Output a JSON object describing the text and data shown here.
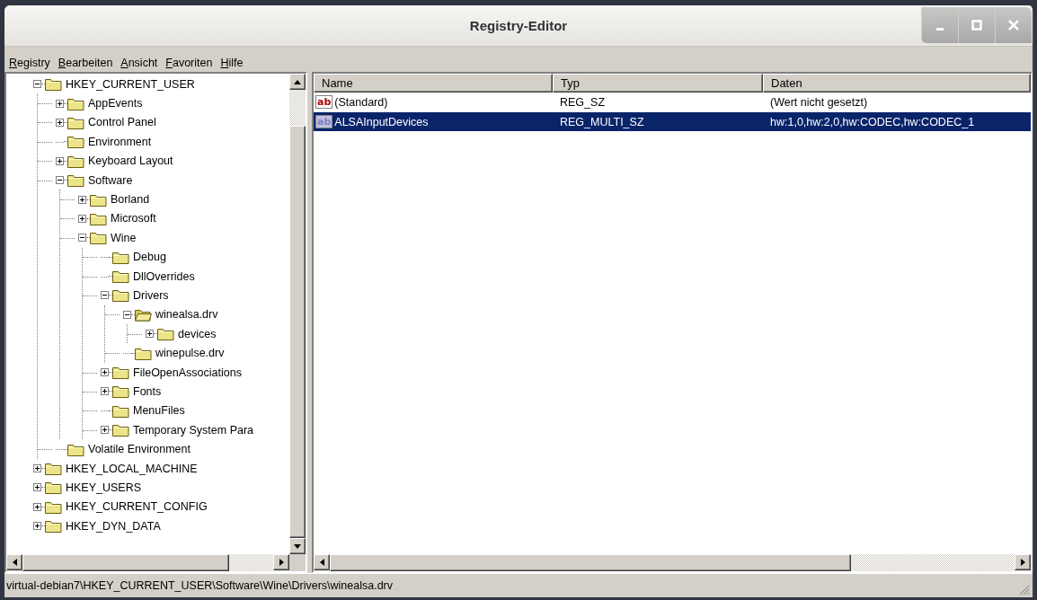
{
  "window": {
    "title": "Registry-Editor"
  },
  "menu": [
    "Registry",
    "Bearbeiten",
    "Ansicht",
    "Favoriten",
    "Hilfe"
  ],
  "tree": [
    {
      "label": "HKEY_CURRENT_USER",
      "kind": "branch",
      "expanded": true,
      "selected": false,
      "children": [
        {
          "label": "AppEvents",
          "kind": "branch",
          "expanded": false,
          "selected": false
        },
        {
          "label": "Control Panel",
          "kind": "branch",
          "expanded": false,
          "selected": false
        },
        {
          "label": "Environment",
          "kind": "leaf",
          "selected": false
        },
        {
          "label": "Keyboard Layout",
          "kind": "branch",
          "expanded": false,
          "selected": false
        },
        {
          "label": "Software",
          "kind": "branch",
          "expanded": true,
          "selected": false,
          "children": [
            {
              "label": "Borland",
              "kind": "branch",
              "expanded": false,
              "selected": false
            },
            {
              "label": "Microsoft",
              "kind": "branch",
              "expanded": false,
              "selected": false
            },
            {
              "label": "Wine",
              "kind": "branch",
              "expanded": true,
              "selected": false,
              "children": [
                {
                  "label": "Debug",
                  "kind": "leaf",
                  "selected": false
                },
                {
                  "label": "DllOverrides",
                  "kind": "leaf",
                  "selected": false
                },
                {
                  "label": "Drivers",
                  "kind": "branch",
                  "expanded": true,
                  "selected": false,
                  "children": [
                    {
                      "label": "winealsa.drv",
                      "kind": "branch",
                      "expanded": true,
                      "selected": true,
                      "children": [
                        {
                          "label": "devices",
                          "kind": "branch",
                          "expanded": false,
                          "selected": false
                        }
                      ]
                    },
                    {
                      "label": "winepulse.drv",
                      "kind": "leaf",
                      "selected": false
                    }
                  ]
                },
                {
                  "label": "FileOpenAssociations",
                  "kind": "branch",
                  "expanded": false,
                  "selected": false
                },
                {
                  "label": "Fonts",
                  "kind": "branch",
                  "expanded": false,
                  "selected": false
                },
                {
                  "label": "MenuFiles",
                  "kind": "leaf",
                  "selected": false
                },
                {
                  "label": "Temporary System Para",
                  "kind": "branch",
                  "expanded": false,
                  "selected": false
                }
              ]
            }
          ]
        },
        {
          "label": "Volatile Environment",
          "kind": "leaf",
          "selected": false
        }
      ]
    },
    {
      "label": "HKEY_LOCAL_MACHINE",
      "kind": "branch",
      "expanded": false,
      "selected": false
    },
    {
      "label": "HKEY_USERS",
      "kind": "branch",
      "expanded": false,
      "selected": false
    },
    {
      "label": "HKEY_CURRENT_CONFIG",
      "kind": "branch",
      "expanded": false,
      "selected": false
    },
    {
      "label": "HKEY_DYN_DATA",
      "kind": "branch",
      "expanded": false,
      "selected": false
    }
  ],
  "values": {
    "columns": [
      "Name",
      "Typ",
      "Daten"
    ],
    "rows": [
      {
        "icon": "ab",
        "name": "(Standard)",
        "type": "REG_SZ",
        "data": "(Wert nicht gesetzt)",
        "selected": false
      },
      {
        "icon": "ab",
        "name": "ALSAInputDevices",
        "type": "REG_MULTI_SZ",
        "data": "hw:1,0,hw:2,0,hw:CODEC,hw:CODEC_1",
        "selected": true
      }
    ]
  },
  "status_bar": "virtual-debian7\\HKEY_CURRENT_USER\\Software\\Wine\\Drivers\\winealsa.drv"
}
